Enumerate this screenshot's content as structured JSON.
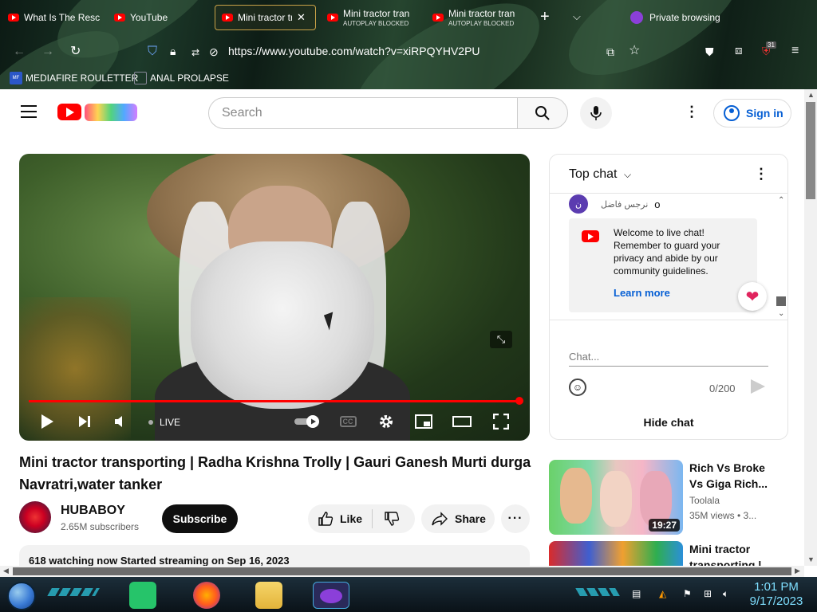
{
  "browser": {
    "tabs": [
      {
        "title": "What Is The Resc",
        "sub": ""
      },
      {
        "title": "YouTube",
        "sub": ""
      },
      {
        "title": "Mini tractor tr",
        "sub": ""
      },
      {
        "title": "Mini tractor tran",
        "sub": "AUTOPLAY BLOCKED"
      },
      {
        "title": "Mini tractor tran",
        "sub": "AUTOPLAY BLOCKED"
      }
    ],
    "private_label": "Private browsing",
    "url": "https://www.youtube.com/watch?v=xiRPQYHV2PU",
    "bookmarks": [
      {
        "icon_text": "MF\nT",
        "label": "MEDIAFIRE ROULETTER"
      },
      {
        "icon_text": "",
        "label": "ANAL PROLAPSE"
      }
    ],
    "badge_count": "31"
  },
  "yt": {
    "search_placeholder": "Search",
    "signin_label": "Sign in"
  },
  "player": {
    "live_label": "LIVE",
    "cc_label": "CC"
  },
  "video": {
    "title": "Mini tractor transporting | Radha Krishna Trolly | Gauri Ganesh Murti durga Navratri,water tanker",
    "channel": "HUBABOY",
    "subscribers": "2.65M subscribers",
    "subscribe_label": "Subscribe",
    "like_label": "Like",
    "share_label": "Share",
    "description_line": "618 watching now  Started streaming on Sep 16, 2023"
  },
  "chat": {
    "header": "Top chat",
    "message_name": "نرجس فاضل",
    "message_text": "o",
    "message_avatar": "ن",
    "welcome_text": "Welcome to live chat! Remember to guard your privacy and abide by our community guidelines.",
    "learn_more": "Learn more",
    "input_placeholder": "Chat...",
    "char_count": "0/200",
    "hide_label": "Hide chat"
  },
  "related": [
    {
      "title": "Rich Vs Broke Vs Giga Rich...",
      "channel": "Toolala",
      "meta": "35M views  •  3...",
      "duration": "19:27"
    },
    {
      "title": "Mini tractor transporting |",
      "channel": "",
      "meta": "",
      "duration": ""
    }
  ],
  "taskbar": {
    "time": "1:01 PM",
    "date": "9/17/2023"
  },
  "colors": {
    "yt_red": "#ff0000",
    "link_blue": "#065fd4"
  }
}
